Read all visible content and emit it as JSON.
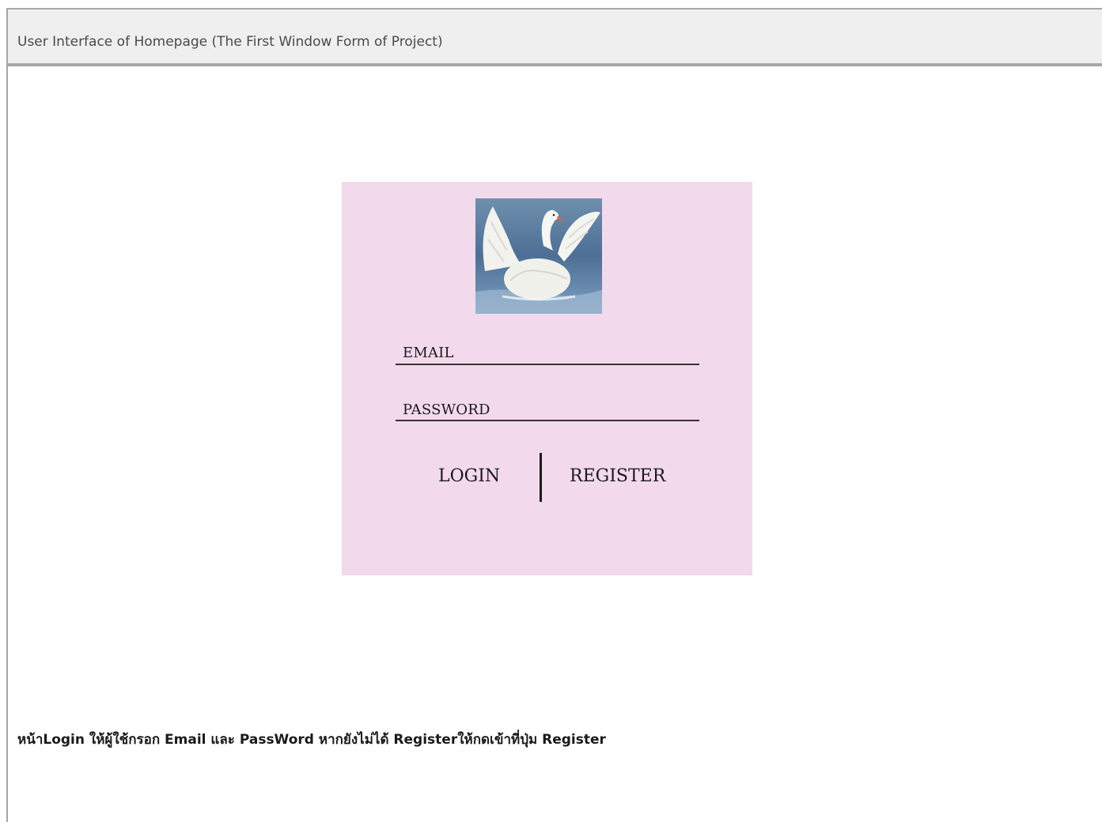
{
  "header": {
    "title": "User Interface of Homepage (The First Window Form of Project)"
  },
  "login_form": {
    "logo_icon": "swan-image",
    "email_label": "EMAIL",
    "password_label": "PASSWORD",
    "login_label": "LOGIN",
    "register_label": "REGISTER",
    "background_color": "#f3d9ec"
  },
  "description": {
    "text": "หน้าLogin ให้ผู้ใช้กรอก Email และ PassWord หากยังไม่ได้ Registerให้กดเข้าที่ปุ่ม Register"
  }
}
